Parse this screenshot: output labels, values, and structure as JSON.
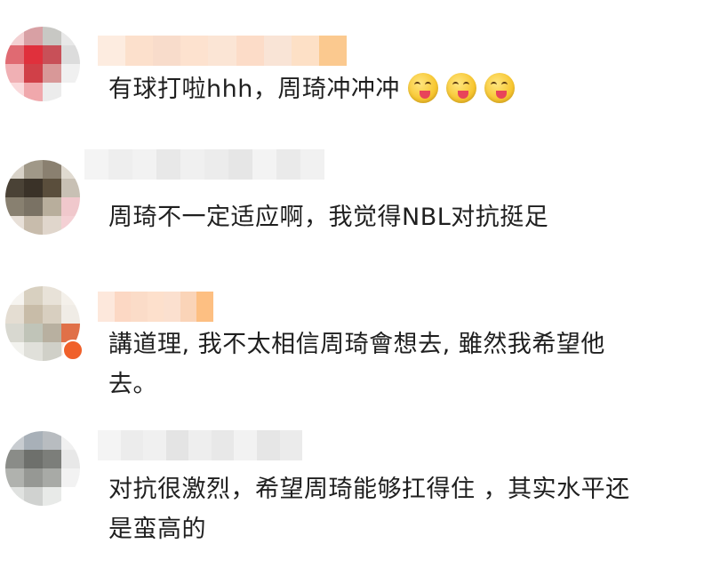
{
  "comments": [
    {
      "text": "有球打啦hhh，周琦冲冲冲",
      "emojis": [
        "yummy-face-emoji",
        "yummy-face-emoji",
        "yummy-face-emoji"
      ],
      "avatar_colors": [
        "#f3d0d2",
        "#d8a0a4",
        "#c8c8c4",
        "#e8e8e8",
        "#e06a72",
        "#e0303c",
        "#c85058",
        "#dcdcdc",
        "#f0b0b4",
        "#d04048",
        "#d89898",
        "#f0f0f0",
        "#fadadc",
        "#f0a8ac",
        "#ececec",
        "#ffffff"
      ],
      "name_colors": [
        "#fdece0",
        "#fce0cc",
        "#f8dccb",
        "#fde2cf",
        "#fbe5d5",
        "#fcdcc8",
        "#f9e4d6",
        "#fde0c6",
        "#fbc98f"
      ]
    },
    {
      "text": "周琦不一定适应啊，我觉得NBL对抗挺足",
      "avatar_colors": [
        "#d8d2c8",
        "#a09888",
        "#8a8070",
        "#e0dad0",
        "#4a4236",
        "#3a3228",
        "#5a4e3c",
        "#c8c0b4",
        "#888070",
        "#7a7264",
        "#b8ae9c",
        "#f0c8cc",
        "#e8e0d8",
        "#c8bcac",
        "#e0d6cc",
        "#f4d0d4"
      ],
      "name_colors": [
        "#f4f4f4",
        "#eeeeee",
        "#f2f2f2",
        "#e8e8e8",
        "#f0f0f0",
        "#ececec",
        "#e6e6e6",
        "#f3f3f3",
        "#eaeaea",
        "#f1f1f1"
      ]
    },
    {
      "text_lines": [
        "講道理, 我不太相信周琦會想去, 雖然我希望他",
        "去。"
      ],
      "avatar_colors": [
        "#f6f4f0",
        "#d8d0c0",
        "#e8e2d8",
        "#f4f0ea",
        "#e4ddd2",
        "#c8bca8",
        "#d8cfc0",
        "#f0ece6",
        "#d8d8d0",
        "#c0c4b8",
        "#b8b0a0",
        "#e07048",
        "#f2f2ee",
        "#e0e0da",
        "#d0d0c8",
        "#f8e8e0"
      ],
      "name_colors": [
        "#fde8dc",
        "#fcd8c4",
        "#fbdcc8",
        "#fde0cc",
        "#fbe0cf",
        "#fad4b8",
        "#fdbf82"
      ]
    },
    {
      "text_lines": [
        "对抗很激烈，希望周琦能够扛得住 ，其实水平还",
        "是蛮高的"
      ],
      "avatar_colors": [
        "#c8ccd0",
        "#a8b0b8",
        "#b8bcc0",
        "#f0f0f0",
        "#8a8c88",
        "#6e706c",
        "#7c7e7a",
        "#e8e8e8",
        "#b0b2ae",
        "#969894",
        "#a8aaa6",
        "#f2f2f2",
        "#e0e2e0",
        "#d0d2d0",
        "#e8eae8",
        "#ffffff"
      ],
      "name_colors": [
        "#f4f4f4",
        "#ececec",
        "#f0f0f0",
        "#e4e4e4",
        "#eeeeee",
        "#e8e8e8",
        "#f2f2f2",
        "#e6e6e6",
        "#ebebeb"
      ]
    }
  ]
}
